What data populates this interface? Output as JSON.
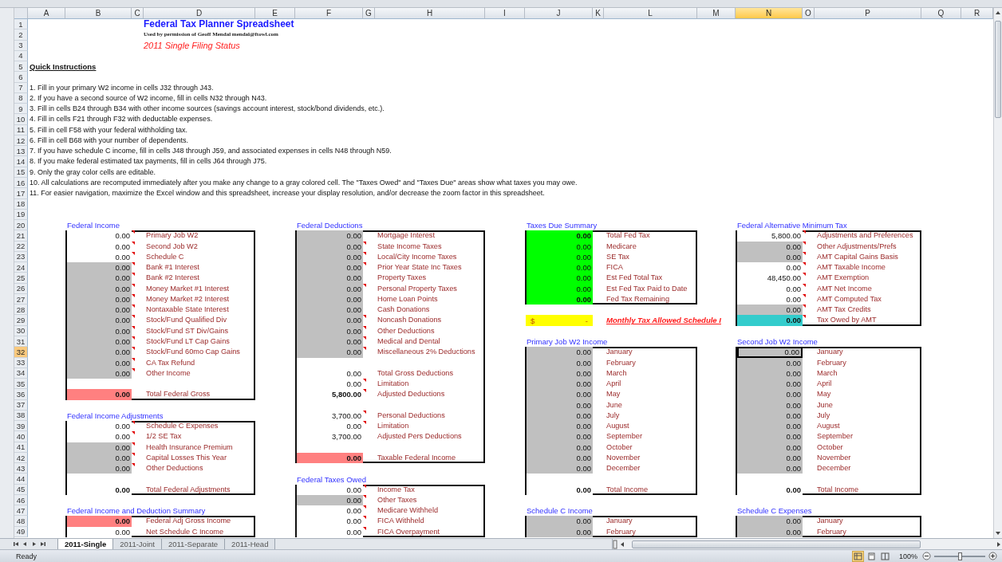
{
  "column_headers": [
    {
      "label": "A",
      "selected": false
    },
    {
      "label": "B",
      "selected": false
    },
    {
      "label": "C",
      "selected": false
    },
    {
      "label": "D",
      "selected": false
    },
    {
      "label": "E",
      "selected": false
    },
    {
      "label": "F",
      "selected": false
    },
    {
      "label": "G",
      "selected": false
    },
    {
      "label": "H",
      "selected": false
    },
    {
      "label": "I",
      "selected": false
    },
    {
      "label": "J",
      "selected": false
    },
    {
      "label": "K",
      "selected": false
    },
    {
      "label": "L",
      "selected": false
    },
    {
      "label": "M",
      "selected": false
    },
    {
      "label": "N",
      "selected": true
    },
    {
      "label": "O",
      "selected": false
    },
    {
      "label": "P",
      "selected": false
    },
    {
      "label": "Q",
      "selected": false
    },
    {
      "label": "R",
      "selected": false
    }
  ],
  "row_numbers": [
    {
      "label": "1",
      "selected": false
    },
    {
      "label": "2",
      "selected": false
    },
    {
      "label": "3",
      "selected": false
    },
    {
      "label": "4",
      "selected": false
    },
    {
      "label": "5",
      "selected": false
    },
    {
      "label": "6",
      "selected": false
    },
    {
      "label": "7",
      "selected": false
    },
    {
      "label": "8",
      "selected": false
    },
    {
      "label": "9",
      "selected": false
    },
    {
      "label": "10",
      "selected": false
    },
    {
      "label": "11",
      "selected": false
    },
    {
      "label": "12",
      "selected": false
    },
    {
      "label": "13",
      "selected": false
    },
    {
      "label": "14",
      "selected": false
    },
    {
      "label": "15",
      "selected": false
    },
    {
      "label": "16",
      "selected": false
    },
    {
      "label": "17",
      "selected": false
    },
    {
      "label": "18",
      "selected": false
    },
    {
      "label": "19",
      "selected": false
    },
    {
      "label": "20",
      "selected": false
    },
    {
      "label": "21",
      "selected": false
    },
    {
      "label": "22",
      "selected": false
    },
    {
      "label": "23",
      "selected": false
    },
    {
      "label": "24",
      "selected": false
    },
    {
      "label": "25",
      "selected": false
    },
    {
      "label": "26",
      "selected": false
    },
    {
      "label": "27",
      "selected": false
    },
    {
      "label": "28",
      "selected": false
    },
    {
      "label": "29",
      "selected": false
    },
    {
      "label": "30",
      "selected": false
    },
    {
      "label": "31",
      "selected": false
    },
    {
      "label": "32",
      "selected": true
    },
    {
      "label": "33",
      "selected": false
    },
    {
      "label": "34",
      "selected": false
    },
    {
      "label": "35",
      "selected": false
    },
    {
      "label": "36",
      "selected": false
    },
    {
      "label": "37",
      "selected": false
    },
    {
      "label": "38",
      "selected": false
    },
    {
      "label": "39",
      "selected": false
    },
    {
      "label": "40",
      "selected": false
    },
    {
      "label": "41",
      "selected": false
    },
    {
      "label": "42",
      "selected": false
    },
    {
      "label": "43",
      "selected": false
    },
    {
      "label": "44",
      "selected": false
    },
    {
      "label": "45",
      "selected": false
    },
    {
      "label": "46",
      "selected": false
    },
    {
      "label": "47",
      "selected": false
    },
    {
      "label": "48",
      "selected": false
    },
    {
      "label": "49",
      "selected": false
    }
  ],
  "header": {
    "title": "Federal Tax Planner Spreadsheet",
    "credit": "Used by permission of Geoff Mendal mendal@ftowl.com",
    "subtitle": "2011 Single Filing Status",
    "instructions_heading": "Quick Instructions"
  },
  "instructions": [
    "1. Fill in your primary W2 income in cells J32 through J43.",
    "2. If you have a second source of W2 income, fill in cells N32 through N43.",
    "3. Fill in cells B24 through B34 with other income sources (savings account interest, stock/bond dividends, etc.).",
    "4. Fill in cells F21 through F32 with deductable expenses.",
    "5. Fill in cell F58 with your federal withholding tax.",
    "6. Fill in cell B68 with your number of dependents.",
    "7. If you have schedule C income, fill in cells J48 through J59, and associated expenses in cells N48 through N59.",
    "8. If you make federal estimated tax payments, fill in cells J64 through J75.",
    "9. Only the gray color cells are editable.",
    "10. All calculations are recomputed immediately after you make any change to a gray colored cell.  The \"Taxes Owed\" and \"Taxes Due\" areas show what taxes you may owe.",
    "11. For easier navigation, maximize the Excel window and this spreadsheet, increase your display resolution, and/or decrease the zoom factor in this spreadsheet."
  ],
  "panels": [
    {
      "sections": [
        {
          "kind": "table",
          "title": "Federal Income",
          "rows": [
            {
              "kind": "entry",
              "value": "0.00",
              "label": "Primary Job W2",
              "color": "#ffffff",
              "bold": false,
              "comment": true,
              "selected": false
            },
            {
              "kind": "entry",
              "value": "0.00",
              "label": "Second Job W2",
              "color": "#ffffff",
              "bold": false,
              "comment": true,
              "selected": false
            },
            {
              "kind": "entry",
              "value": "0.00",
              "label": "Schedule C",
              "color": "#ffffff",
              "bold": false,
              "comment": true,
              "selected": false
            },
            {
              "kind": "entry",
              "value": "0.00",
              "label": "Bank #1 Interest",
              "color": "#c0c0c0",
              "bold": false,
              "comment": true,
              "selected": false
            },
            {
              "kind": "entry",
              "value": "0.00",
              "label": "Bank #2 Interest",
              "color": "#c0c0c0",
              "bold": false,
              "comment": true,
              "selected": false
            },
            {
              "kind": "entry",
              "value": "0.00",
              "label": "Money Market #1 Interest",
              "color": "#c0c0c0",
              "bold": false,
              "comment": true,
              "selected": false
            },
            {
              "kind": "entry",
              "value": "0.00",
              "label": "Money Market #2 Interest",
              "color": "#c0c0c0",
              "bold": false,
              "comment": true,
              "selected": false
            },
            {
              "kind": "entry",
              "value": "0.00",
              "label": "Nontaxable State Interest",
              "color": "#c0c0c0",
              "bold": false,
              "comment": true,
              "selected": false
            },
            {
              "kind": "entry",
              "value": "0.00",
              "label": "Stock/Fund Qualified Div",
              "color": "#c0c0c0",
              "bold": false,
              "comment": true,
              "selected": false
            },
            {
              "kind": "entry",
              "value": "0.00",
              "label": "Stock/Fund ST Div/Gains",
              "color": "#c0c0c0",
              "bold": false,
              "comment": true,
              "selected": false
            },
            {
              "kind": "entry",
              "value": "0.00",
              "label": "Stock/Fund LT Cap Gains",
              "color": "#c0c0c0",
              "bold": false,
              "comment": true,
              "selected": false
            },
            {
              "kind": "entry",
              "value": "0.00",
              "label": "Stock/Fund 60mo Cap Gains",
              "color": "#c0c0c0",
              "bold": false,
              "comment": true,
              "selected": false
            },
            {
              "kind": "entry",
              "value": "0.00",
              "label": "CA Tax Refund",
              "color": "#c0c0c0",
              "bold": false,
              "comment": true,
              "selected": false
            },
            {
              "kind": "entry",
              "value": "0.00",
              "label": "Other Income",
              "color": "#c0c0c0",
              "bold": false,
              "comment": true,
              "selected": false
            },
            {
              "kind": "blank"
            },
            {
              "kind": "entry",
              "value": "0.00",
              "label": "Total Federal Gross",
              "color": "#ff8080",
              "bold": true,
              "comment": false,
              "selected": false
            }
          ]
        },
        {
          "kind": "table",
          "title": "Federal Income Adjustments",
          "rows": [
            {
              "kind": "entry",
              "value": "0.00",
              "label": "Schedule C Expenses",
              "color": "#ffffff",
              "bold": false,
              "comment": true,
              "selected": false
            },
            {
              "kind": "entry",
              "value": "0.00",
              "label": "1/2 SE Tax",
              "color": "#ffffff",
              "bold": false,
              "comment": true,
              "selected": false
            },
            {
              "kind": "entry",
              "value": "0.00",
              "label": "Health Insurance Premium",
              "color": "#c0c0c0",
              "bold": false,
              "comment": true,
              "selected": false
            },
            {
              "kind": "entry",
              "value": "0.00",
              "label": "Capital Losses This Year",
              "color": "#c0c0c0",
              "bold": false,
              "comment": true,
              "selected": false
            },
            {
              "kind": "entry",
              "value": "0.00",
              "label": "Other Deductions",
              "color": "#c0c0c0",
              "bold": false,
              "comment": true,
              "selected": false
            },
            {
              "kind": "blank"
            },
            {
              "kind": "entry",
              "value": "0.00",
              "label": "Total Federal Adjustments",
              "color": "#ffffff",
              "bold": true,
              "comment": false,
              "selected": false
            }
          ]
        },
        {
          "kind": "table",
          "title": "Federal Income and Deduction Summary",
          "rows": [
            {
              "kind": "entry",
              "value": "0.00",
              "label": "Federal Adj Gross Income",
              "color": "#ff8080",
              "bold": true,
              "comment": false,
              "selected": false
            },
            {
              "kind": "entry",
              "value": "0.00",
              "label": "Net Schedule C Income",
              "color": "#ffffff",
              "bold": false,
              "comment": false,
              "selected": false
            }
          ]
        }
      ]
    },
    {
      "sections": [
        {
          "kind": "table",
          "title": "Federal Deductions",
          "rows": [
            {
              "kind": "entry",
              "value": "0.00",
              "label": "Mortgage Interest",
              "color": "#c0c0c0",
              "bold": false,
              "comment": false,
              "selected": false
            },
            {
              "kind": "entry",
              "value": "0.00",
              "label": "State Income Taxes",
              "color": "#c0c0c0",
              "bold": false,
              "comment": true,
              "selected": false
            },
            {
              "kind": "entry",
              "value": "0.00",
              "label": "Local/City Income Taxes",
              "color": "#c0c0c0",
              "bold": false,
              "comment": true,
              "selected": false
            },
            {
              "kind": "entry",
              "value": "0.00",
              "label": "Prior Year State Inc Taxes",
              "color": "#c0c0c0",
              "bold": false,
              "comment": true,
              "selected": false
            },
            {
              "kind": "entry",
              "value": "0.00",
              "label": "Property Taxes",
              "color": "#c0c0c0",
              "bold": false,
              "comment": false,
              "selected": false
            },
            {
              "kind": "entry",
              "value": "0.00",
              "label": "Personal Property Taxes",
              "color": "#c0c0c0",
              "bold": false,
              "comment": true,
              "selected": false
            },
            {
              "kind": "entry",
              "value": "0.00",
              "label": "Home Loan Points",
              "color": "#c0c0c0",
              "bold": false,
              "comment": false,
              "selected": false
            },
            {
              "kind": "entry",
              "value": "0.00",
              "label": "Cash Donations",
              "color": "#c0c0c0",
              "bold": false,
              "comment": false,
              "selected": false
            },
            {
              "kind": "entry",
              "value": "0.00",
              "label": "Noncash Donations",
              "color": "#c0c0c0",
              "bold": false,
              "comment": true,
              "selected": false
            },
            {
              "kind": "entry",
              "value": "0.00",
              "label": "Other Deductions",
              "color": "#c0c0c0",
              "bold": false,
              "comment": true,
              "selected": false
            },
            {
              "kind": "entry",
              "value": "0.00",
              "label": "Medical and Dental",
              "color": "#c0c0c0",
              "bold": false,
              "comment": true,
              "selected": false
            },
            {
              "kind": "entry",
              "value": "0.00",
              "label": "Miscellaneous 2% Deductions",
              "color": "#c0c0c0",
              "bold": false,
              "comment": true,
              "selected": false
            },
            {
              "kind": "blank"
            },
            {
              "kind": "entry",
              "value": "0.00",
              "label": "Total Gross Deductions",
              "color": "#ffffff",
              "bold": false,
              "comment": false,
              "selected": false
            },
            {
              "kind": "entry",
              "value": "0.00",
              "label": "Limitation",
              "color": "#ffffff",
              "bold": false,
              "comment": true,
              "selected": false
            },
            {
              "kind": "entry",
              "value": "5,800.00",
              "label": "Adjusted Deductions",
              "color": "#ffffff",
              "bold": true,
              "comment": true,
              "selected": false
            },
            {
              "kind": "blank"
            },
            {
              "kind": "entry",
              "value": "3,700.00",
              "label": "Personal Deductions",
              "color": "#ffffff",
              "bold": false,
              "comment": true,
              "selected": false
            },
            {
              "kind": "entry",
              "value": "0.00",
              "label": "Limitation",
              "color": "#ffffff",
              "bold": false,
              "comment": true,
              "selected": false
            },
            {
              "kind": "entry",
              "value": "3,700.00",
              "label": "Adjusted Pers Deductions",
              "color": "#ffffff",
              "bold": false,
              "comment": false,
              "selected": false
            },
            {
              "kind": "blank"
            },
            {
              "kind": "entry",
              "value": "0.00",
              "label": "Taxable Federal Income",
              "color": "#ff8080",
              "bold": true,
              "comment": false,
              "selected": false
            }
          ]
        },
        {
          "kind": "table",
          "title": "Federal Taxes Owed",
          "rows": [
            {
              "kind": "entry",
              "value": "0.00",
              "label": "Income Tax",
              "color": "#ffffff",
              "bold": false,
              "comment": true,
              "selected": false
            },
            {
              "kind": "entry",
              "value": "0.00",
              "label": "Other Taxes",
              "color": "#c0c0c0",
              "bold": false,
              "comment": true,
              "selected": false
            },
            {
              "kind": "entry",
              "value": "0.00",
              "label": "Medicare Withheld",
              "color": "#ffffff",
              "bold": false,
              "comment": true,
              "selected": false
            },
            {
              "kind": "entry",
              "value": "0.00",
              "label": "FICA Withheld",
              "color": "#ffffff",
              "bold": false,
              "comment": true,
              "selected": false
            },
            {
              "kind": "entry",
              "value": "0.00",
              "label": "FICA Overpayment",
              "color": "#ffffff",
              "bold": false,
              "comment": true,
              "selected": false
            }
          ]
        }
      ]
    },
    {
      "sections": [
        {
          "kind": "table",
          "title": "Taxes Due Summary",
          "rows": [
            {
              "kind": "entry",
              "value": "0.00",
              "label": "Total Fed Tax",
              "color": "#00ff00",
              "bold": true,
              "comment": false,
              "selected": false
            },
            {
              "kind": "entry",
              "value": "0.00",
              "label": "Medicare",
              "color": "#00ff00",
              "bold": false,
              "comment": false,
              "selected": false
            },
            {
              "kind": "entry",
              "value": "0.00",
              "label": "SE Tax",
              "color": "#00ff00",
              "bold": false,
              "comment": false,
              "selected": false
            },
            {
              "kind": "entry",
              "value": "0.00",
              "label": "FICA",
              "color": "#00ff00",
              "bold": false,
              "comment": false,
              "selected": false
            },
            {
              "kind": "entry",
              "value": "0.00",
              "label": "Est Fed Total Tax",
              "color": "#00ff00",
              "bold": false,
              "comment": false,
              "selected": false
            },
            {
              "kind": "entry",
              "value": "0.00",
              "label": "Est Fed Tax Paid to Date",
              "color": "#00ff00",
              "bold": false,
              "comment": false,
              "selected": false
            },
            {
              "kind": "entry",
              "value": "0.00",
              "label": "Fed Tax Remaining",
              "color": "#00ff00",
              "bold": true,
              "comment": false,
              "selected": false
            }
          ]
        },
        {
          "kind": "note",
          "currency": "$",
          "value": "-",
          "caption": "Monthly Tax Allowed Schedule I",
          "color": "#ffff00"
        },
        {
          "kind": "table",
          "title": "Primary Job W2 Income",
          "rows": [
            {
              "kind": "entry",
              "value": "0.00",
              "label": "January",
              "color": "#c0c0c0",
              "bold": false,
              "comment": false,
              "selected": false
            },
            {
              "kind": "entry",
              "value": "0.00",
              "label": "February",
              "color": "#c0c0c0",
              "bold": false,
              "comment": false,
              "selected": false
            },
            {
              "kind": "entry",
              "value": "0.00",
              "label": "March",
              "color": "#c0c0c0",
              "bold": false,
              "comment": false,
              "selected": false
            },
            {
              "kind": "entry",
              "value": "0.00",
              "label": "April",
              "color": "#c0c0c0",
              "bold": false,
              "comment": false,
              "selected": false
            },
            {
              "kind": "entry",
              "value": "0.00",
              "label": "May",
              "color": "#c0c0c0",
              "bold": false,
              "comment": false,
              "selected": false
            },
            {
              "kind": "entry",
              "value": "0.00",
              "label": "June",
              "color": "#c0c0c0",
              "bold": false,
              "comment": false,
              "selected": false
            },
            {
              "kind": "entry",
              "value": "0.00",
              "label": "July",
              "color": "#c0c0c0",
              "bold": false,
              "comment": false,
              "selected": false
            },
            {
              "kind": "entry",
              "value": "0.00",
              "label": "August",
              "color": "#c0c0c0",
              "bold": false,
              "comment": false,
              "selected": false
            },
            {
              "kind": "entry",
              "value": "0.00",
              "label": "September",
              "color": "#c0c0c0",
              "bold": false,
              "comment": false,
              "selected": false
            },
            {
              "kind": "entry",
              "value": "0.00",
              "label": "October",
              "color": "#c0c0c0",
              "bold": false,
              "comment": false,
              "selected": false
            },
            {
              "kind": "entry",
              "value": "0.00",
              "label": "November",
              "color": "#c0c0c0",
              "bold": false,
              "comment": false,
              "selected": false
            },
            {
              "kind": "entry",
              "value": "0.00",
              "label": "December",
              "color": "#c0c0c0",
              "bold": false,
              "comment": false,
              "selected": false
            },
            {
              "kind": "blank"
            },
            {
              "kind": "entry",
              "value": "0.00",
              "label": "Total Income",
              "color": "#ffffff",
              "bold": true,
              "comment": false,
              "selected": false
            }
          ]
        },
        {
          "kind": "table",
          "title": "Schedule C Income",
          "rows": [
            {
              "kind": "entry",
              "value": "0.00",
              "label": "January",
              "color": "#c0c0c0",
              "bold": false,
              "comment": false,
              "selected": false
            },
            {
              "kind": "entry",
              "value": "0.00",
              "label": "February",
              "color": "#c0c0c0",
              "bold": false,
              "comment": false,
              "selected": false
            }
          ]
        }
      ]
    },
    {
      "sections": [
        {
          "kind": "table",
          "title": "Federal Alternative Minimum Tax",
          "rows": [
            {
              "kind": "entry",
              "value": "5,800.00",
              "label": "Adjustments and Preferences",
              "color": "#ffffff",
              "bold": false,
              "comment": true,
              "selected": false
            },
            {
              "kind": "entry",
              "value": "0.00",
              "label": "Other Adjustments/Prefs",
              "color": "#c0c0c0",
              "bold": false,
              "comment": true,
              "selected": false
            },
            {
              "kind": "entry",
              "value": "0.00",
              "label": "AMT Capital Gains Basis",
              "color": "#c0c0c0",
              "bold": false,
              "comment": true,
              "selected": false
            },
            {
              "kind": "entry",
              "value": "0.00",
              "label": "AMT Taxable Income",
              "color": "#ffffff",
              "bold": false,
              "comment": true,
              "selected": false
            },
            {
              "kind": "entry",
              "value": "48,450.00",
              "label": "AMT Exemption",
              "color": "#ffffff",
              "bold": false,
              "comment": true,
              "selected": false
            },
            {
              "kind": "entry",
              "value": "0.00",
              "label": "AMT Net Income",
              "color": "#ffffff",
              "bold": false,
              "comment": true,
              "selected": false
            },
            {
              "kind": "entry",
              "value": "0.00",
              "label": "AMT Computed Tax",
              "color": "#ffffff",
              "bold": false,
              "comment": true,
              "selected": false
            },
            {
              "kind": "entry",
              "value": "0.00",
              "label": "AMT Tax Credits",
              "color": "#c0c0c0",
              "bold": false,
              "comment": true,
              "selected": false
            },
            {
              "kind": "entry",
              "value": "0.00",
              "label": "Tax Owed by AMT",
              "color": "#33cccc",
              "bold": true,
              "comment": true,
              "selected": false
            }
          ]
        },
        {
          "kind": "table",
          "title": "Second Job W2 Income",
          "rows": [
            {
              "kind": "entry",
              "value": "0.00",
              "label": "January",
              "color": "#c0c0c0",
              "bold": false,
              "comment": false,
              "selected": true
            },
            {
              "kind": "entry",
              "value": "0.00",
              "label": "February",
              "color": "#c0c0c0",
              "bold": false,
              "comment": false,
              "selected": false
            },
            {
              "kind": "entry",
              "value": "0.00",
              "label": "March",
              "color": "#c0c0c0",
              "bold": false,
              "comment": false,
              "selected": false
            },
            {
              "kind": "entry",
              "value": "0.00",
              "label": "April",
              "color": "#c0c0c0",
              "bold": false,
              "comment": false,
              "selected": false
            },
            {
              "kind": "entry",
              "value": "0.00",
              "label": "May",
              "color": "#c0c0c0",
              "bold": false,
              "comment": false,
              "selected": false
            },
            {
              "kind": "entry",
              "value": "0.00",
              "label": "June",
              "color": "#c0c0c0",
              "bold": false,
              "comment": false,
              "selected": false
            },
            {
              "kind": "entry",
              "value": "0.00",
              "label": "July",
              "color": "#c0c0c0",
              "bold": false,
              "comment": false,
              "selected": false
            },
            {
              "kind": "entry",
              "value": "0.00",
              "label": "August",
              "color": "#c0c0c0",
              "bold": false,
              "comment": false,
              "selected": false
            },
            {
              "kind": "entry",
              "value": "0.00",
              "label": "September",
              "color": "#c0c0c0",
              "bold": false,
              "comment": false,
              "selected": false
            },
            {
              "kind": "entry",
              "value": "0.00",
              "label": "October",
              "color": "#c0c0c0",
              "bold": false,
              "comment": false,
              "selected": false
            },
            {
              "kind": "entry",
              "value": "0.00",
              "label": "November",
              "color": "#c0c0c0",
              "bold": false,
              "comment": false,
              "selected": false
            },
            {
              "kind": "entry",
              "value": "0.00",
              "label": "December",
              "color": "#c0c0c0",
              "bold": false,
              "comment": false,
              "selected": false
            },
            {
              "kind": "blank"
            },
            {
              "kind": "entry",
              "value": "0.00",
              "label": "Total Income",
              "color": "#ffffff",
              "bold": true,
              "comment": false,
              "selected": false
            }
          ]
        },
        {
          "kind": "table",
          "title": "Schedule C Expenses",
          "rows": [
            {
              "kind": "entry",
              "value": "0.00",
              "label": "January",
              "color": "#c0c0c0",
              "bold": false,
              "comment": false,
              "selected": false
            },
            {
              "kind": "entry",
              "value": "0.00",
              "label": "February",
              "color": "#c0c0c0",
              "bold": false,
              "comment": false,
              "selected": false
            }
          ]
        }
      ]
    }
  ],
  "sheet_tabs": [
    {
      "label": "2011-Single",
      "selected": true
    },
    {
      "label": "2011-Joint",
      "selected": false
    },
    {
      "label": "2011-Separate",
      "selected": false
    },
    {
      "label": "2011-Head",
      "selected": false
    }
  ],
  "status_bar": {
    "text": "Ready",
    "views": [
      {
        "selected": true
      },
      {
        "selected": false
      },
      {
        "selected": false
      }
    ],
    "zoom": {
      "label": "100%",
      "level": 0.5
    }
  }
}
